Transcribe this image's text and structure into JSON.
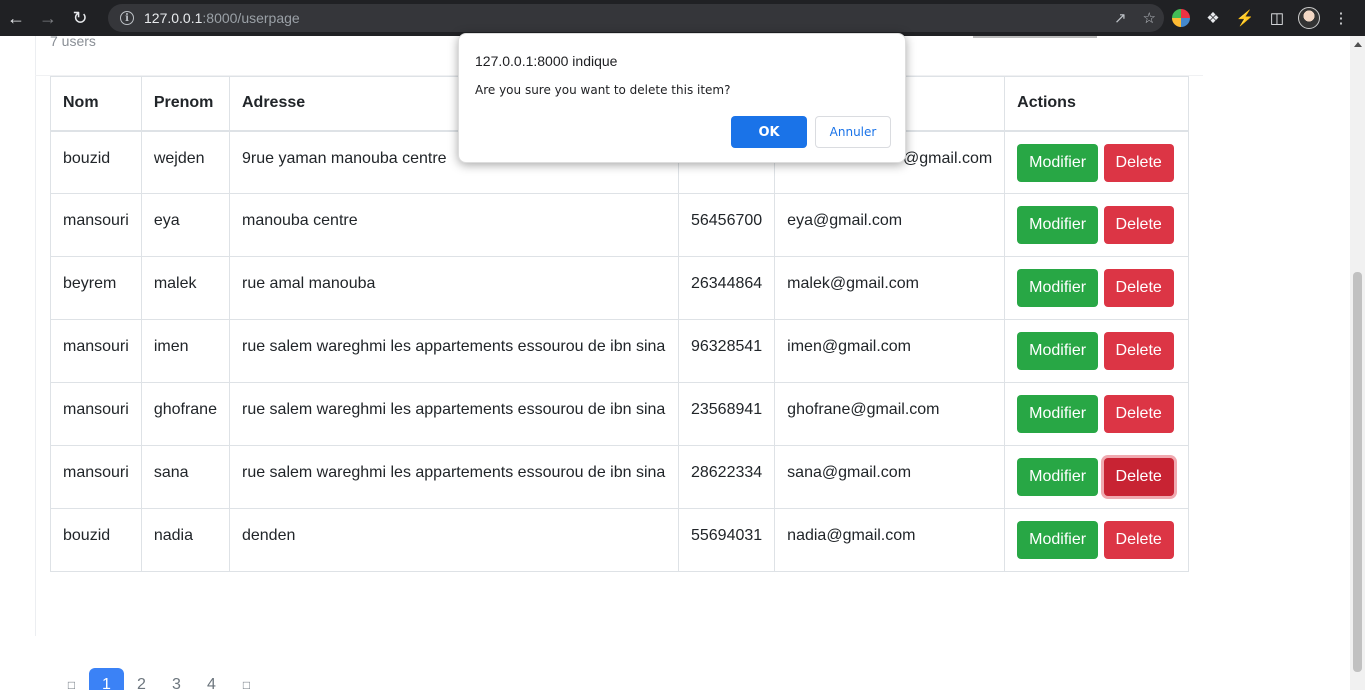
{
  "browser": {
    "url_host": "127.0.0.1",
    "url_rest": ":8000/userpage"
  },
  "page": {
    "user_count": "7 users",
    "columns": [
      "Nom",
      "Prenom",
      "Adresse",
      "Actions"
    ],
    "rows": [
      {
        "nom": "bouzid",
        "prenom": "wejden",
        "adresse": "9rue yaman manouba centre",
        "tel": "",
        "email": "@gmail.com"
      },
      {
        "nom": "mansouri",
        "prenom": "eya",
        "adresse": "manouba centre",
        "tel": "56456700",
        "email": "eya@gmail.com"
      },
      {
        "nom": "beyrem",
        "prenom": "malek",
        "adresse": "rue amal manouba",
        "tel": "26344864",
        "email": "malek@gmail.com"
      },
      {
        "nom": "mansouri",
        "prenom": "imen",
        "adresse": "rue salem wareghmi les appartements essourou de ibn sina",
        "tel": "96328541",
        "email": "imen@gmail.com"
      },
      {
        "nom": "mansouri",
        "prenom": "ghofrane",
        "adresse": "rue salem wareghmi les appartements essourou de ibn sina",
        "tel": "23568941",
        "email": "ghofrane@gmail.com"
      },
      {
        "nom": "mansouri",
        "prenom": "sana",
        "adresse": "rue salem wareghmi les appartements essourou de ibn sina",
        "tel": "28622334",
        "email": "sana@gmail.com"
      },
      {
        "nom": "bouzid",
        "prenom": "nadia",
        "adresse": "denden",
        "tel": "55694031",
        "email": "nadia@gmail.com"
      }
    ],
    "modify_label": "Modifier",
    "delete_label": "Delete",
    "pagination": {
      "pages": [
        "1",
        "2",
        "3",
        "4"
      ],
      "active": "1"
    }
  },
  "dialog": {
    "title": "127.0.0.1:8000 indique",
    "message": "Are you sure you want to delete this item?",
    "ok_label": "OK",
    "cancel_label": "Annuler"
  }
}
